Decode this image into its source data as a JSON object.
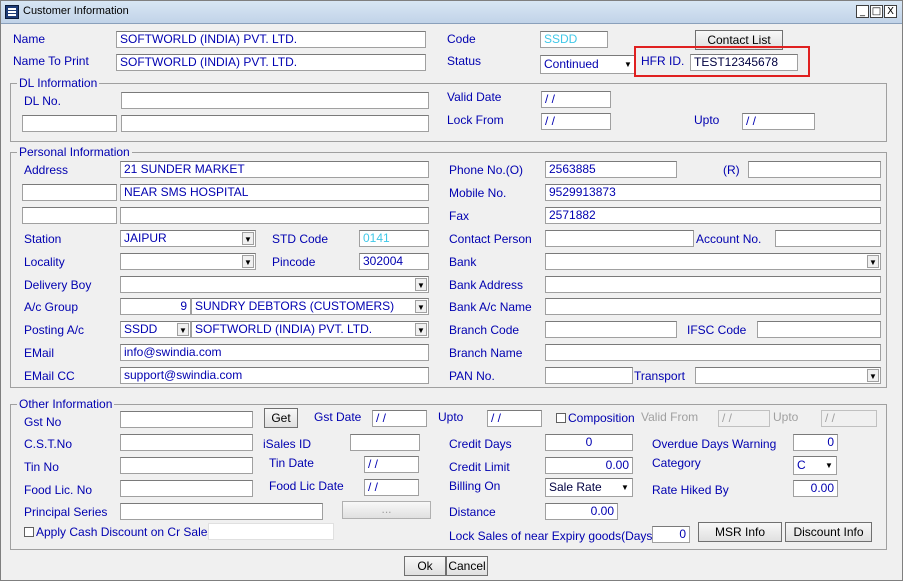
{
  "window": {
    "title": "Customer Information",
    "min": "_",
    "max": "□",
    "close": "X"
  },
  "top": {
    "name_label": "Name",
    "name_value": "SOFTWORLD (INDIA) PVT. LTD.",
    "print_label": "Name To Print",
    "print_value": "SOFTWORLD (INDIA) PVT. LTD.",
    "code_label": "Code",
    "code_value": "SSDD",
    "status_label": "Status",
    "status_value": "Continued",
    "contact_list": "Contact List",
    "hfr_label": "HFR ID.",
    "hfr_value": "TEST12345678"
  },
  "dl": {
    "title": "DL Information",
    "dl_no_label": "DL No.",
    "valid_label": "Valid Date",
    "valid_value": "/ /",
    "lock_label": "Lock From",
    "lock_value": "/ /",
    "upto_label": "Upto",
    "upto_value": "/ /"
  },
  "personal": {
    "title": "Personal Information",
    "address_label": "Address",
    "address1": "21 SUNDER MARKET",
    "address2": "NEAR SMS HOSPITAL",
    "address3": "",
    "phone_o_label": "Phone No.(O)",
    "phone_o": "2563885",
    "r_label": "(R)",
    "phone_r": "",
    "mobile_label": "Mobile No.",
    "mobile": "9529913873",
    "fax_label": "Fax",
    "fax": "2571882",
    "station_label": "Station",
    "station": "JAIPUR",
    "std_label": "STD Code",
    "std": "0141",
    "contact_label": "Contact Person",
    "contact": "",
    "account_label": "Account No.",
    "account": "",
    "locality_label": "Locality",
    "locality": "",
    "pincode_label": "Pincode",
    "pincode": "302004",
    "bank_label": "Bank",
    "bank": "",
    "delivery_label": "Delivery Boy",
    "delivery": "",
    "bank_address_label": "Bank Address",
    "bank_address": "",
    "ac_group_label": "A/c Group",
    "ac_group_no": "9",
    "ac_group": "SUNDRY DEBTORS (CUSTOMERS)",
    "bank_ac_name_label": "Bank A/c Name",
    "bank_ac_name": "",
    "posting_label": "Posting A/c",
    "posting_code": "SSDD",
    "posting_name": "SOFTWORLD (INDIA) PVT. LTD.",
    "branch_code_label": "Branch Code",
    "branch_code": "",
    "ifsc_label": "IFSC Code",
    "ifsc": "",
    "email_label": "EMail",
    "email": "info@swindia.com",
    "branch_name_label": "Branch Name",
    "branch_name": "",
    "emailcc_label": "EMail CC",
    "emailcc": "support@swindia.com",
    "pan_label": "PAN No.",
    "pan": "",
    "transport_label": "Transport",
    "transport": ""
  },
  "other": {
    "title": "Other Information",
    "gst_label": "Gst No",
    "get_btn": "Get",
    "gst_date_label": "Gst Date",
    "gst_date": "/ /",
    "upto_label": "Upto",
    "upto_value": "/ /",
    "composition_label": "Composition",
    "valid_from_label": "Valid From",
    "valid_from": "/ /",
    "upto2_label": "Upto",
    "upto2_value": "/ /",
    "cst_label": "C.S.T.No",
    "isales_label": "iSales ID",
    "credit_days_label": "Credit Days",
    "credit_days": "0",
    "overdue_label": "Overdue Days Warning",
    "overdue": "0",
    "tin_label": "Tin No",
    "tin_date_label": "Tin Date",
    "tin_date": "/ /",
    "credit_limit_label": "Credit Limit",
    "credit_limit": "0.00",
    "category_label": "Category",
    "category": "C",
    "food_label": "Food Lic. No",
    "food_date_label": "Food Lic Date",
    "food_date": "/ /",
    "billing_label": "Billing On",
    "billing": "Sale Rate",
    "rate_hiked_label": "Rate Hiked By",
    "rate_hiked": "0.00",
    "principal_label": "Principal Series",
    "principal_btn": "...",
    "distance_label": "Distance",
    "distance": "0.00",
    "apply_label": "Apply Cash Discount on Cr Sales",
    "lock_sales_label": "Lock Sales of near Expiry goods(Days)",
    "lock_sales": "0",
    "msr_btn": "MSR Info",
    "discount_btn": "Discount Info"
  },
  "footer": {
    "ok": "Ok",
    "cancel": "Cancel"
  }
}
